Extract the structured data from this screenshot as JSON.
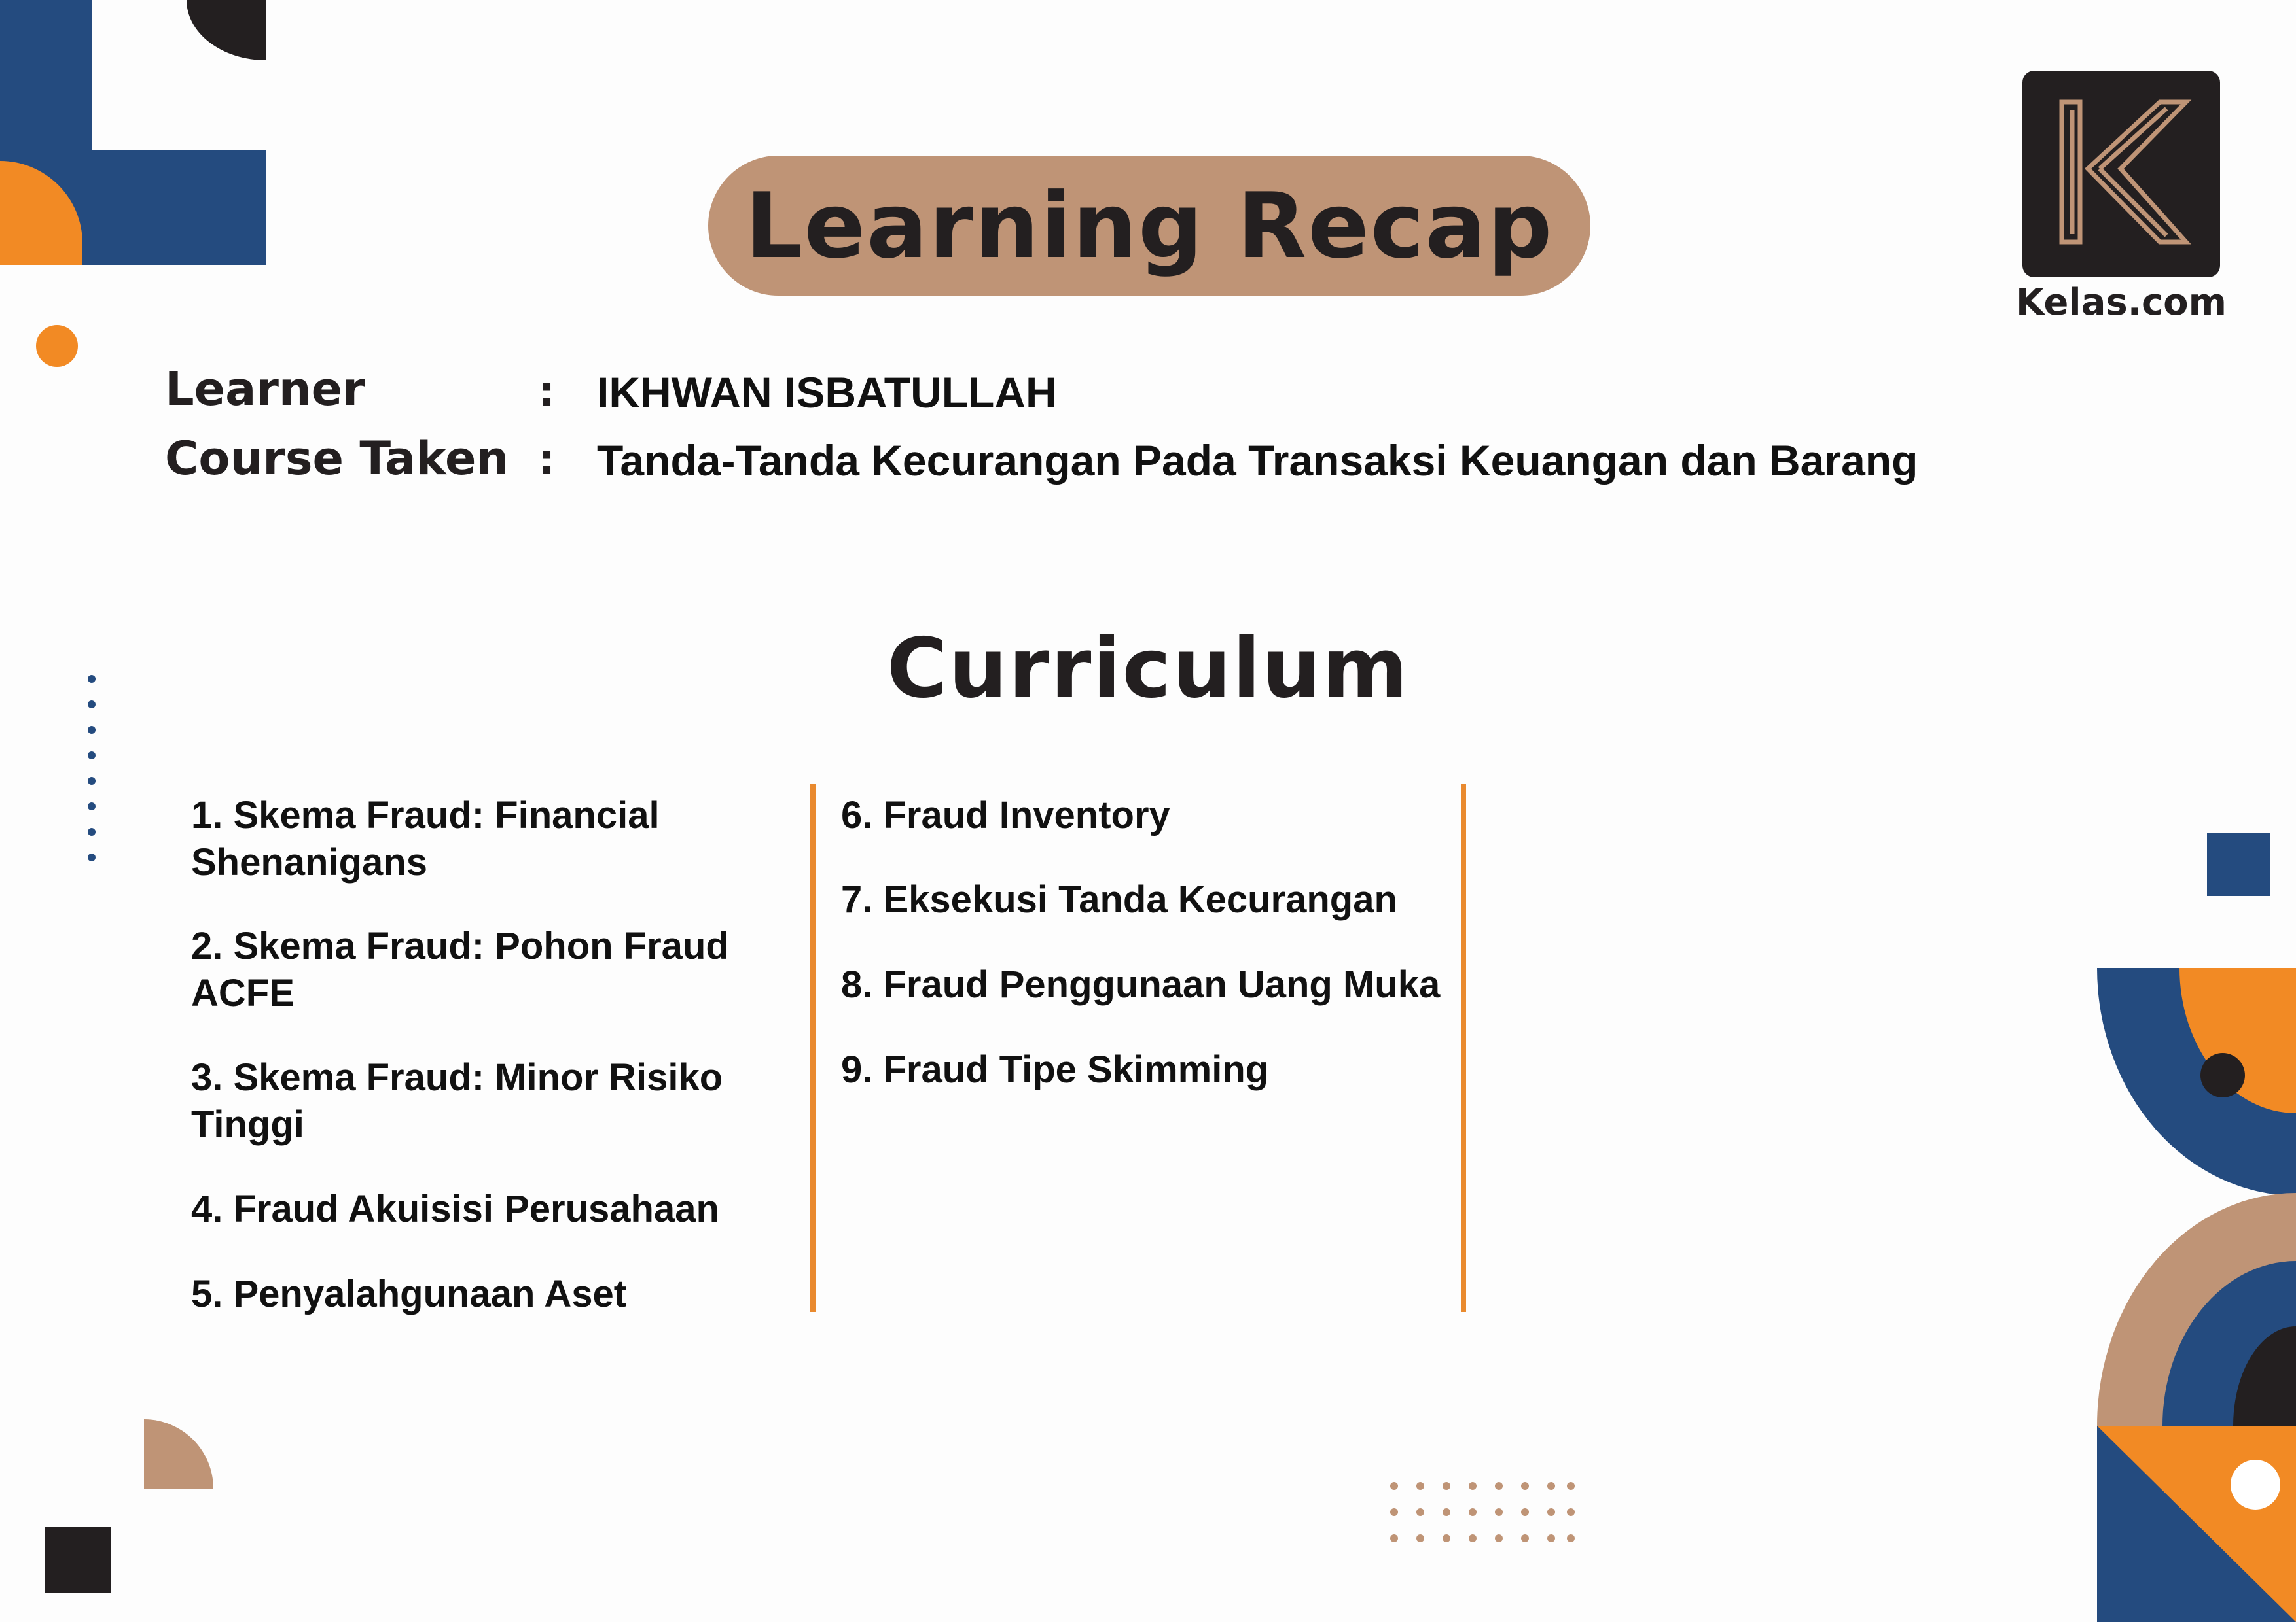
{
  "title": "Learning Recap",
  "brand": {
    "name": "Kelas.com",
    "logo_letter": "K"
  },
  "learner": {
    "label": "Learner",
    "separator": ":",
    "value": "IKHWAN ISBATULLAH"
  },
  "course": {
    "label": "Course Taken",
    "separator": ":",
    "value": "Tanda-Tanda Kecurangan Pada Transaksi Keuangan dan Barang"
  },
  "curriculum": {
    "heading": "Curriculum",
    "left_column": [
      "1. Skema Fraud: Financial Shenanigans",
      "2. Skema Fraud: Pohon Fraud ACFE",
      "3. Skema Fraud: Minor Risiko Tinggi",
      "4. Fraud Akuisisi Perusahaan",
      "5. Penyalahgunaan Aset"
    ],
    "right_column": [
      "6. Fraud Inventory",
      "7. Eksekusi Tanda Kecurangan",
      "8. Fraud Penggunaan Uang Muka",
      "9. Fraud Tipe Skimming"
    ]
  },
  "colors": {
    "navy": "#244b7f",
    "orange": "#f28a24",
    "tan": "#bf9476",
    "dark": "#231f20",
    "divider": "#e98a2f"
  }
}
